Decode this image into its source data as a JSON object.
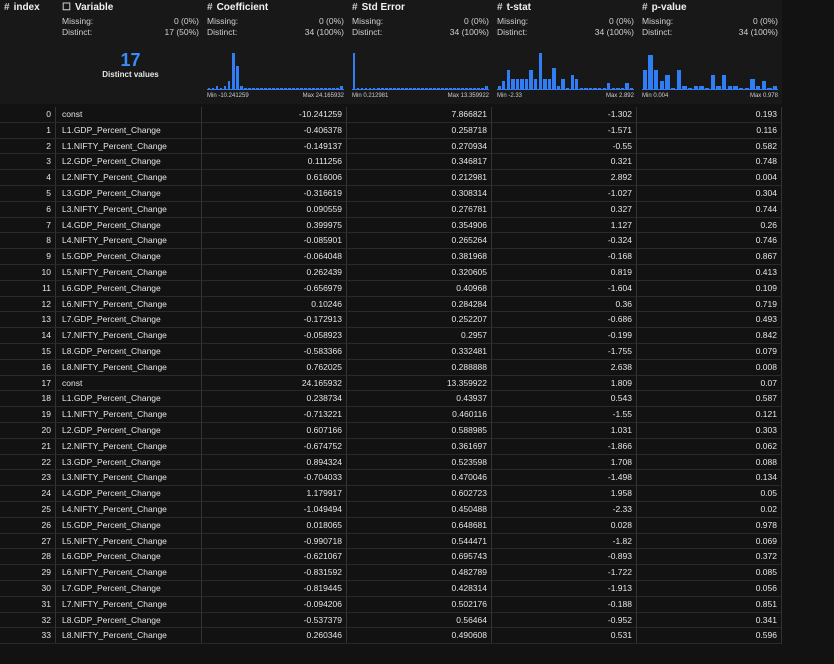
{
  "columns": [
    {
      "key": "index",
      "label": "index",
      "icon": "#"
    },
    {
      "key": "variable",
      "label": "Variable",
      "icon": "☐"
    },
    {
      "key": "coefficient",
      "label": "Coefficient",
      "icon": "#"
    },
    {
      "key": "std_error",
      "label": "Std Error",
      "icon": "#"
    },
    {
      "key": "t_stat",
      "label": "t-stat",
      "icon": "#"
    },
    {
      "key": "p_value",
      "label": "p-value",
      "icon": "#"
    }
  ],
  "summary": {
    "missing_label": "Missing:",
    "distinct_label": "Distinct:",
    "variable": {
      "missing": "0 (0%)",
      "distinct": "17 (50%)",
      "distinct_count": "17",
      "distinct_caption": "Distinct values"
    },
    "coefficient": {
      "missing": "0 (0%)",
      "distinct": "34 (100%)",
      "min": "Min -10.241259",
      "max": "Max 24.165932",
      "hist": [
        0.05,
        0.05,
        0.1,
        0.05,
        0.1,
        0.2,
        0.85,
        0.55,
        0.1,
        0.05,
        0.05,
        0.05,
        0.05,
        0.05,
        0.05,
        0.05,
        0.05,
        0.05,
        0.05,
        0.05,
        0.05,
        0.05,
        0.05,
        0.05,
        0.05,
        0.05,
        0.05,
        0.05,
        0.05,
        0.05,
        0.05,
        0.05,
        0.05,
        0.1
      ]
    },
    "std_error": {
      "missing": "0 (0%)",
      "distinct": "34 (100%)",
      "min": "Min 0.212981",
      "max": "Max 13.359922",
      "hist": [
        0.85,
        0.05,
        0.05,
        0.05,
        0.05,
        0.05,
        0.05,
        0.05,
        0.05,
        0.05,
        0.05,
        0.05,
        0.05,
        0.05,
        0.05,
        0.05,
        0.05,
        0.05,
        0.05,
        0.05,
        0.05,
        0.05,
        0.05,
        0.05,
        0.05,
        0.05,
        0.05,
        0.05,
        0.05,
        0.05,
        0.05,
        0.05,
        0.05,
        0.1
      ]
    },
    "t_stat": {
      "missing": "0 (0%)",
      "distinct": "34 (100%)",
      "min": "Min -2.33",
      "max": "Max 2.892",
      "hist": [
        0.1,
        0.2,
        0.45,
        0.25,
        0.25,
        0.25,
        0.25,
        0.45,
        0.25,
        0.85,
        0.25,
        0.25,
        0.5,
        0.1,
        0.25,
        0.05,
        0.35,
        0.25,
        0.05,
        0.05,
        0.05,
        0.05,
        0.05,
        0.05,
        0.15,
        0.05,
        0.05,
        0.05,
        0.15,
        0.05
      ]
    },
    "p_value": {
      "missing": "0 (0%)",
      "distinct": "34 (100%)",
      "min": "Min 0.004",
      "max": "Max 0.978",
      "hist": [
        0.45,
        0.8,
        0.45,
        0.2,
        0.35,
        0.05,
        0.45,
        0.1,
        0.05,
        0.1,
        0.1,
        0.05,
        0.35,
        0.1,
        0.35,
        0.1,
        0.1,
        0.05,
        0.05,
        0.25,
        0.1,
        0.2,
        0.05,
        0.1
      ]
    }
  },
  "rows": [
    [
      "0",
      "const",
      "-10.241259",
      "7.866821",
      "-1.302",
      "0.193"
    ],
    [
      "1",
      "L1.GDP_Percent_Change",
      "-0.406378",
      "0.258718",
      "-1.571",
      "0.116"
    ],
    [
      "2",
      "L1.NIFTY_Percent_Change",
      "-0.149137",
      "0.270934",
      "-0.55",
      "0.582"
    ],
    [
      "3",
      "L2.GDP_Percent_Change",
      "0.111256",
      "0.346817",
      "0.321",
      "0.748"
    ],
    [
      "4",
      "L2.NIFTY_Percent_Change",
      "0.616006",
      "0.212981",
      "2.892",
      "0.004"
    ],
    [
      "5",
      "L3.GDP_Percent_Change",
      "-0.316619",
      "0.308314",
      "-1.027",
      "0.304"
    ],
    [
      "6",
      "L3.NIFTY_Percent_Change",
      "0.090559",
      "0.276781",
      "0.327",
      "0.744"
    ],
    [
      "7",
      "L4.GDP_Percent_Change",
      "0.399975",
      "0.354906",
      "1.127",
      "0.26"
    ],
    [
      "8",
      "L4.NIFTY_Percent_Change",
      "-0.085901",
      "0.265264",
      "-0.324",
      "0.746"
    ],
    [
      "9",
      "L5.GDP_Percent_Change",
      "-0.064048",
      "0.381968",
      "-0.168",
      "0.867"
    ],
    [
      "10",
      "L5.NIFTY_Percent_Change",
      "0.262439",
      "0.320605",
      "0.819",
      "0.413"
    ],
    [
      "11",
      "L6.GDP_Percent_Change",
      "-0.656979",
      "0.40968",
      "-1.604",
      "0.109"
    ],
    [
      "12",
      "L6.NIFTY_Percent_Change",
      "0.10246",
      "0.284284",
      "0.36",
      "0.719"
    ],
    [
      "13",
      "L7.GDP_Percent_Change",
      "-0.172913",
      "0.252207",
      "-0.686",
      "0.493"
    ],
    [
      "14",
      "L7.NIFTY_Percent_Change",
      "-0.058923",
      "0.2957",
      "-0.199",
      "0.842"
    ],
    [
      "15",
      "L8.GDP_Percent_Change",
      "-0.583366",
      "0.332481",
      "-1.755",
      "0.079"
    ],
    [
      "16",
      "L8.NIFTY_Percent_Change",
      "0.762025",
      "0.288888",
      "2.638",
      "0.008"
    ],
    [
      "17",
      "const",
      "24.165932",
      "13.359922",
      "1.809",
      "0.07"
    ],
    [
      "18",
      "L1.GDP_Percent_Change",
      "0.238734",
      "0.43937",
      "0.543",
      "0.587"
    ],
    [
      "19",
      "L1.NIFTY_Percent_Change",
      "-0.713221",
      "0.460116",
      "-1.55",
      "0.121"
    ],
    [
      "20",
      "L2.GDP_Percent_Change",
      "0.607166",
      "0.588985",
      "1.031",
      "0.303"
    ],
    [
      "21",
      "L2.NIFTY_Percent_Change",
      "-0.674752",
      "0.361697",
      "-1.866",
      "0.062"
    ],
    [
      "22",
      "L3.GDP_Percent_Change",
      "0.894324",
      "0.523598",
      "1.708",
      "0.088"
    ],
    [
      "23",
      "L3.NIFTY_Percent_Change",
      "-0.704033",
      "0.470046",
      "-1.498",
      "0.134"
    ],
    [
      "24",
      "L4.GDP_Percent_Change",
      "1.179917",
      "0.602723",
      "1.958",
      "0.05"
    ],
    [
      "25",
      "L4.NIFTY_Percent_Change",
      "-1.049494",
      "0.450488",
      "-2.33",
      "0.02"
    ],
    [
      "26",
      "L5.GDP_Percent_Change",
      "0.018065",
      "0.648681",
      "0.028",
      "0.978"
    ],
    [
      "27",
      "L5.NIFTY_Percent_Change",
      "-0.990718",
      "0.544471",
      "-1.82",
      "0.069"
    ],
    [
      "28",
      "L6.GDP_Percent_Change",
      "-0.621067",
      "0.695743",
      "-0.893",
      "0.372"
    ],
    [
      "29",
      "L6.NIFTY_Percent_Change",
      "-0.831592",
      "0.482789",
      "-1.722",
      "0.085"
    ],
    [
      "30",
      "L7.GDP_Percent_Change",
      "-0.819445",
      "0.428314",
      "-1.913",
      "0.056"
    ],
    [
      "31",
      "L7.NIFTY_Percent_Change",
      "-0.094206",
      "0.502176",
      "-0.188",
      "0.851"
    ],
    [
      "32",
      "L8.GDP_Percent_Change",
      "-0.537379",
      "0.56464",
      "-0.952",
      "0.341"
    ],
    [
      "33",
      "L8.NIFTY_Percent_Change",
      "0.260346",
      "0.490608",
      "0.531",
      "0.596"
    ]
  ],
  "colors": {
    "accent": "#2f7ef6",
    "distinct": "#3b8cff",
    "background": "#121212",
    "header": "#181818"
  }
}
